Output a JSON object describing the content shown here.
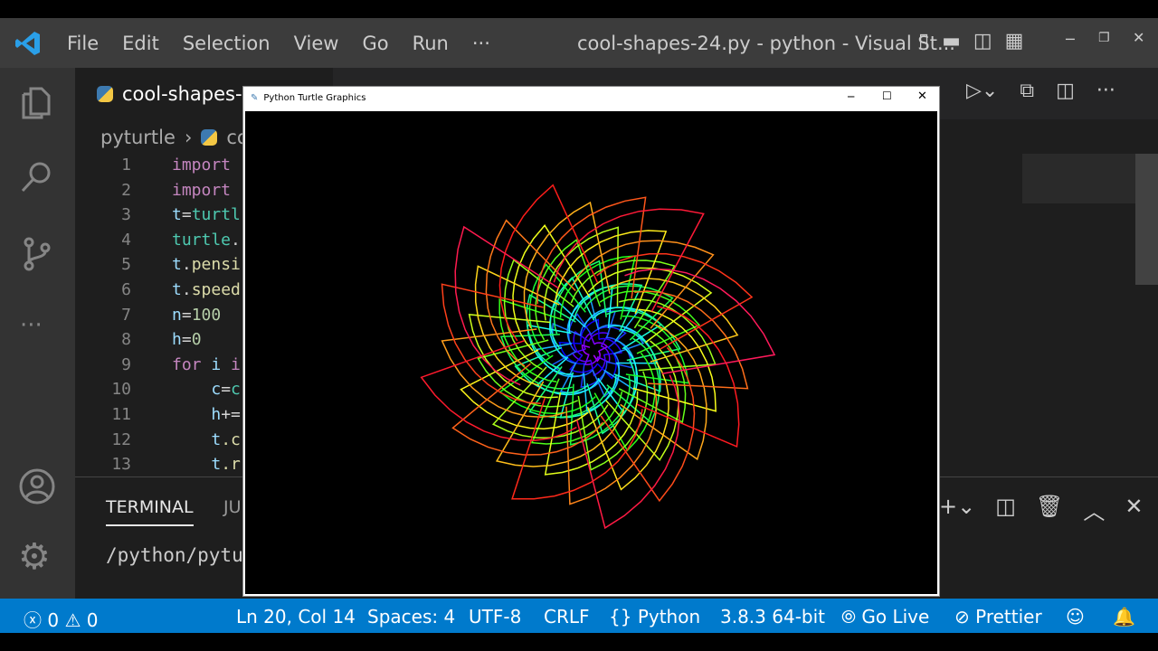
{
  "window": {
    "title": "cool-shapes-24.py - python - Visual St..."
  },
  "menu": [
    "File",
    "Edit",
    "Selection",
    "View",
    "Go",
    "Run",
    "···"
  ],
  "tab": {
    "label": "cool-shapes-"
  },
  "breadcrumb": {
    "folder": "pyturtle",
    "file": "co"
  },
  "code": [
    [
      {
        "t": "import",
        "c": "#c586c0"
      }
    ],
    [
      {
        "t": "import",
        "c": "#c586c0"
      }
    ],
    [
      {
        "t": "t",
        "c": "#9cdcfe"
      },
      {
        "t": "=",
        "c": "#d4d4d4"
      },
      {
        "t": "turtl",
        "c": "#4ec9b0"
      }
    ],
    [
      {
        "t": "turtle",
        "c": "#4ec9b0"
      },
      {
        "t": ".",
        "c": "#d4d4d4"
      }
    ],
    [
      {
        "t": "t",
        "c": "#9cdcfe"
      },
      {
        "t": ".",
        "c": "#d4d4d4"
      },
      {
        "t": "pensi",
        "c": "#dcdcaa"
      }
    ],
    [
      {
        "t": "t",
        "c": "#9cdcfe"
      },
      {
        "t": ".",
        "c": "#d4d4d4"
      },
      {
        "t": "speed",
        "c": "#dcdcaa"
      }
    ],
    [
      {
        "t": "n",
        "c": "#9cdcfe"
      },
      {
        "t": "=",
        "c": "#d4d4d4"
      },
      {
        "t": "100",
        "c": "#b5cea8"
      }
    ],
    [
      {
        "t": "h",
        "c": "#9cdcfe"
      },
      {
        "t": "=",
        "c": "#d4d4d4"
      },
      {
        "t": "0",
        "c": "#b5cea8"
      }
    ],
    [
      {
        "t": "for",
        "c": "#c586c0"
      },
      {
        "t": " i ",
        "c": "#9cdcfe"
      },
      {
        "t": "i",
        "c": "#c586c0"
      }
    ],
    [
      {
        "t": "    c",
        "c": "#9cdcfe"
      },
      {
        "t": "=",
        "c": "#d4d4d4"
      },
      {
        "t": "c",
        "c": "#4ec9b0"
      }
    ],
    [
      {
        "t": "    h",
        "c": "#9cdcfe"
      },
      {
        "t": "+=",
        "c": "#d4d4d4"
      }
    ],
    [
      {
        "t": "    t",
        "c": "#9cdcfe"
      },
      {
        "t": ".c",
        "c": "#dcdcaa"
      }
    ],
    [
      {
        "t": "    t",
        "c": "#9cdcfe"
      },
      {
        "t": ".r",
        "c": "#dcdcaa"
      }
    ]
  ],
  "panel": {
    "tabs": [
      "TERMINAL",
      "JU"
    ],
    "terminal_text": "/python/pytu"
  },
  "turtle": {
    "title": "Python Turtle Graphics"
  },
  "status": {
    "errors": "0",
    "warnings": "0",
    "position": "Ln 20, Col 14",
    "spaces": "Spaces: 4",
    "encoding": "UTF-8",
    "eol": "CRLF",
    "language": "Python",
    "interpreter": "3.8.3 64-bit",
    "golive": "Go Live",
    "prettier": "Prettier"
  }
}
